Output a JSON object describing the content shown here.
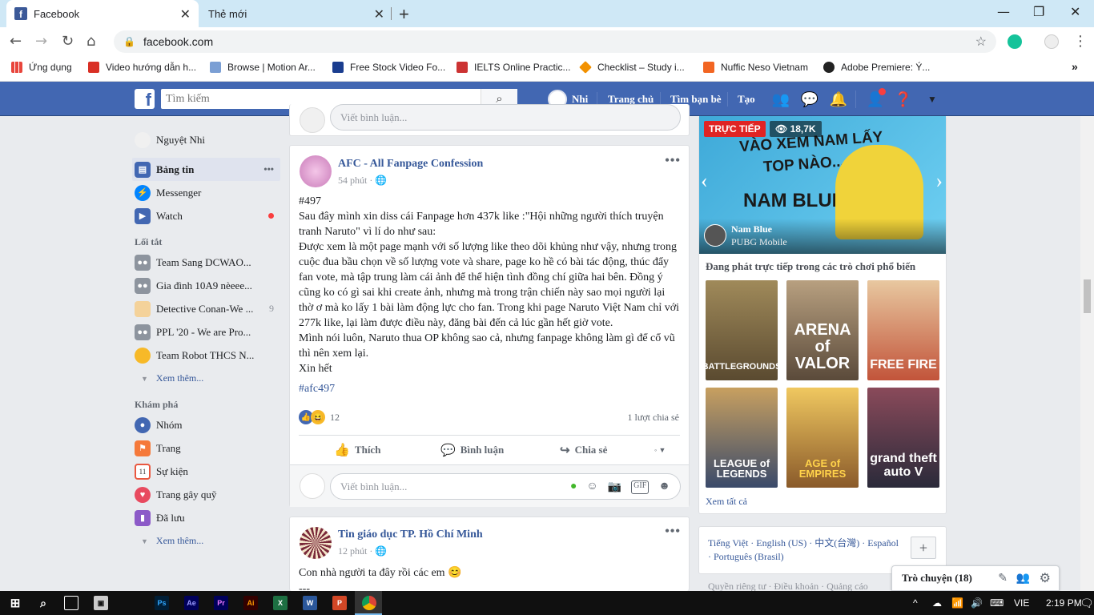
{
  "browser": {
    "tabs": [
      {
        "title": "Facebook"
      },
      {
        "title": "Thẻ mới"
      }
    ],
    "url": "facebook.com",
    "bookmarks": [
      {
        "label": "Ứng dụng",
        "color": "#e8453c"
      },
      {
        "label": "Video hướng dẫn h...",
        "color": "#d93025"
      },
      {
        "label": "Browse | Motion Ar...",
        "color": "#7b9fd4"
      },
      {
        "label": "Free Stock Video Fo...",
        "color": "#1a3d8f"
      },
      {
        "label": "IELTS Online Practic...",
        "color": "#c33"
      },
      {
        "label": "Checklist – Study i...",
        "color": "#f29100"
      },
      {
        "label": "Nuffic Neso Vietnam",
        "color": "#f26522"
      },
      {
        "label": "Adobe Premiere: Ý...",
        "color": "#222"
      }
    ]
  },
  "fb": {
    "search_placeholder": "Tìm kiếm",
    "user_short": "Nhi",
    "nav": [
      "Trang chủ",
      "Tìm bạn bè",
      "Tạo"
    ]
  },
  "sidebar": {
    "user": "Nguyệt Nhi",
    "main": [
      {
        "label": "Bảng tin",
        "icon": "newsfeed-icon",
        "color": "#4267b2"
      },
      {
        "label": "Messenger",
        "icon": "messenger-icon",
        "color": "#0084ff"
      },
      {
        "label": "Watch",
        "icon": "watch-icon",
        "color": "#4267b2"
      }
    ],
    "shortcuts_title": "Lối tắt",
    "shortcuts": [
      {
        "label": "Team Sang DCWAO...",
        "count": ""
      },
      {
        "label": "Gia đình 10A9 nèeee...",
        "count": ""
      },
      {
        "label": "Detective Conan-We ...",
        "count": "9"
      },
      {
        "label": "PPL '20 - We are Pro...",
        "count": ""
      },
      {
        "label": "Team Robot THCS N...",
        "count": ""
      }
    ],
    "see_more": "Xem thêm...",
    "explore_title": "Khám phá",
    "explore": [
      {
        "label": "Nhóm",
        "icon": "groups-icon",
        "color": "#4267b2"
      },
      {
        "label": "Trang",
        "icon": "flag-icon",
        "color": "#f5793a"
      },
      {
        "label": "Sự kiện",
        "icon": "calendar-icon",
        "color": "#e9573f"
      },
      {
        "label": "Trang gây quỹ",
        "icon": "fundraiser-icon",
        "color": "#e84a5f"
      },
      {
        "label": "Đã lưu",
        "icon": "saved-icon",
        "color": "#8c5ac8"
      }
    ],
    "see_more_2": "Xem thêm..."
  },
  "feed": {
    "comment_placeholder": "Viết bình luận...",
    "post1": {
      "page": "AFC - All Fanpage Confession",
      "time": "54 phút",
      "lines": [
        "#497",
        "Sau đây mình xin diss cái Fanpage hơn 437k like :\"Hội những người thích truyện tranh Naruto\" vì lí do như sau:",
        "Được xem là một page mạnh với số lượng like theo dõi khủng như vậy, nhưng trong cuộc đua bầu chọn về số lượng vote và share, page ko hề có bài tác động, thúc đẩy fan vote, mà tập trung làm cái ảnh để thể hiện tình đồng chí giữa hai bên. Đồng ý cũng ko có gì sai khi create ảnh, nhưng mà trong trận chiến này sao mọi người lại thờ ơ mà ko lấy 1 bài làm động lực cho fan. Trong khi page Naruto Việt Nam chỉ với 277k like, lại làm được điều này, đăng bài đến cả lúc gần hết giờ vote.",
        "Mình nói luôn, Naruto thua OP không sao cả, nhưng fanpage không làm gì để cổ vũ thì nên xem lại.",
        "Xin hết"
      ],
      "hashtag": "#afc497",
      "reactions": "12",
      "shares": "1 lượt chia sẻ",
      "actions": [
        "Thích",
        "Bình luận",
        "Chia sẻ"
      ]
    },
    "post2": {
      "page": "Tin giáo dục TP. Hồ Chí Minh",
      "time": "12 phút",
      "text": "Con nhà người ta đây rồi các em 😊",
      "cut": "---"
    }
  },
  "right": {
    "live_badge": "TRỰC TIẾP",
    "viewers": "18,7K",
    "streamer": "Nam Blue",
    "game": "PUBG Mobile",
    "banner_lines": [
      "VÀO XEM NAM LẤY",
      "TOP NÀO...",
      "NAM BLUE"
    ],
    "games_title": "Đang phát trực tiếp trong các trò chơi phổ biến",
    "games": [
      {
        "name": "BATTLEGROUNDS",
        "bg": "#6b5a3e"
      },
      {
        "name": "ARENA of VALOR",
        "bg": "#7a6a5a"
      },
      {
        "name": "FREE FIRE",
        "bg": "#c2543a"
      },
      {
        "name": "LEAGUE of LEGENDS",
        "bg": "#3a4a6a"
      },
      {
        "name": "AGE of EMPIRES",
        "bg": "#b08a3a"
      },
      {
        "name": "grand theft auto V",
        "bg": "#4a3a5a"
      }
    ],
    "see_all": "Xem tất cả",
    "languages": "Tiếng Việt · English (US) · 中文(台灣) · Español · Português (Brasil)",
    "footer": "Quyền riêng tư · Điều khoản · Quảng cáo"
  },
  "chat": {
    "label": "Trò chuyện (18)"
  },
  "taskbar": {
    "lang": "VIE",
    "time": "2:19 PM",
    "apps": [
      {
        "label": "Ps",
        "color": "#001e36",
        "fg": "#31a8ff"
      },
      {
        "label": "Ae",
        "color": "#00005b",
        "fg": "#9999ff"
      },
      {
        "label": "Pr",
        "color": "#00005b",
        "fg": "#ea77ff"
      },
      {
        "label": "Ai",
        "color": "#330000",
        "fg": "#ff9a00"
      },
      {
        "label": "X",
        "color": "#1d6f42",
        "fg": "#fff"
      },
      {
        "label": "W",
        "color": "#2b579a",
        "fg": "#fff"
      },
      {
        "label": "P",
        "color": "#d24726",
        "fg": "#fff"
      }
    ]
  }
}
